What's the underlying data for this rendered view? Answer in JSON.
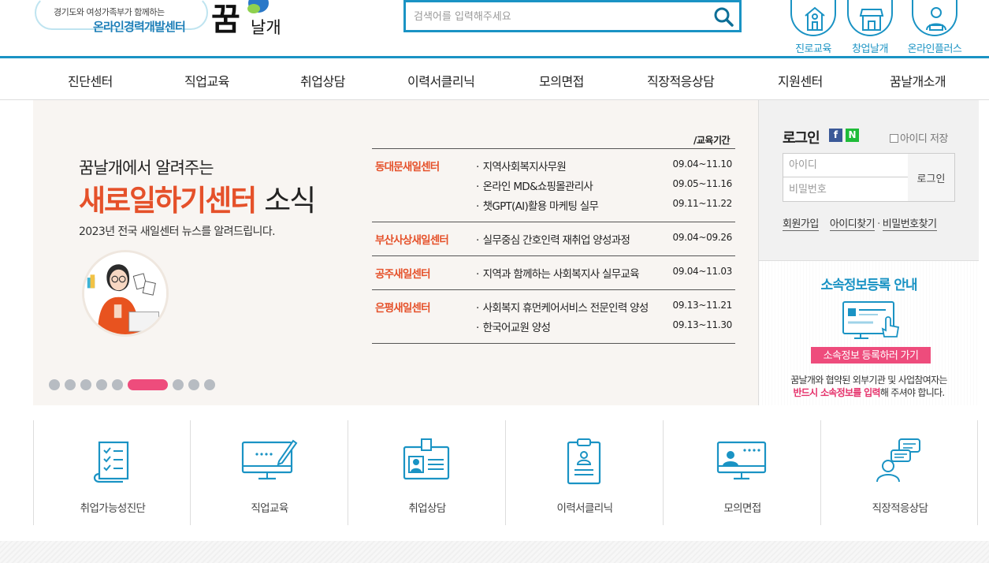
{
  "header": {
    "logo": {
      "subtitle": "경기도와 여성가족부가 함께하는",
      "title": "온라인경력개발센터",
      "brand": "꿈날개"
    },
    "search": {
      "placeholder": "검색어를 입력해주세요"
    },
    "quick_links": [
      {
        "label": "진로교육",
        "icon": "school-icon"
      },
      {
        "label": "창업날개",
        "icon": "store-icon"
      },
      {
        "label": "온라인플러스",
        "icon": "counselor-icon"
      }
    ]
  },
  "nav": [
    "진단센터",
    "직업교육",
    "취업상담",
    "이력서클리닉",
    "모의면접",
    "직장적응상담",
    "지원센터",
    "꿈날개소개"
  ],
  "banner": {
    "intro": "꿈날개에서 알려주는",
    "title_highlight": "새로일하기센터",
    "title_rest": "소식",
    "description": "2023년 전국 새일센터 뉴스를 알려드립니다.",
    "period_label": "/교육기간",
    "schedule": [
      {
        "center": "동대문새일센터",
        "courses": [
          {
            "name": "지역사회복지사무원",
            "date": "09.04~11.10"
          },
          {
            "name": "온라인 MD&쇼핑몰관리사",
            "date": "09.05~11.16"
          },
          {
            "name": "챗GPT(AI)활용 마케팅 실무",
            "date": "09.11~11.22"
          }
        ]
      },
      {
        "center": "부산사상새일센터",
        "courses": [
          {
            "name": "실무중심 간호인력 재취업 양성과정",
            "date": "09.04~09.26"
          }
        ]
      },
      {
        "center": "공주새일센터",
        "courses": [
          {
            "name": "지역과 함께하는 사회복지사 실무교육",
            "date": "09.04~11.03"
          }
        ]
      },
      {
        "center": "은평새일센터",
        "courses": [
          {
            "name": "사회복지 휴먼케어서비스 전문인력 양성",
            "date": "09.13~11.21"
          },
          {
            "name": "한국어교원 양성",
            "date": "09.13~11.30"
          }
        ]
      }
    ],
    "slides": {
      "total": 10,
      "active": 6
    }
  },
  "login": {
    "title": "로그인",
    "facebook": "f",
    "naver": "N",
    "save_id_label": "아이디 저장",
    "id_placeholder": "아이디",
    "pw_placeholder": "비밀번호",
    "button": "로그인",
    "links": {
      "join": "회원가입",
      "find_id": "아이디찾기",
      "separator": "·",
      "find_pw": "비밀번호찾기"
    }
  },
  "notice": {
    "title": "소속정보등록 안내",
    "button": "소속정보 등록하러 가기",
    "text_line1": "꿈날개와 협약된 외부기관 및 사업참여자는",
    "text_strong": "반드시 소속정보를 입력",
    "text_rest": "해 주셔야 합니다."
  },
  "quick_menu": [
    {
      "label": "취업가능성진단",
      "icon": "checklist-icon"
    },
    {
      "label": "직업교육",
      "icon": "monitor-pen-icon"
    },
    {
      "label": "취업상담",
      "icon": "id-card-icon"
    },
    {
      "label": "이력서클리닉",
      "icon": "clipboard-resume-icon"
    },
    {
      "label": "모의면접",
      "icon": "video-interview-icon"
    },
    {
      "label": "직장적응상담",
      "icon": "chat-person-icon"
    }
  ],
  "colors": {
    "primary": "#1a93c4",
    "accent": "#e5512a",
    "pink": "#ee4c7c"
  }
}
